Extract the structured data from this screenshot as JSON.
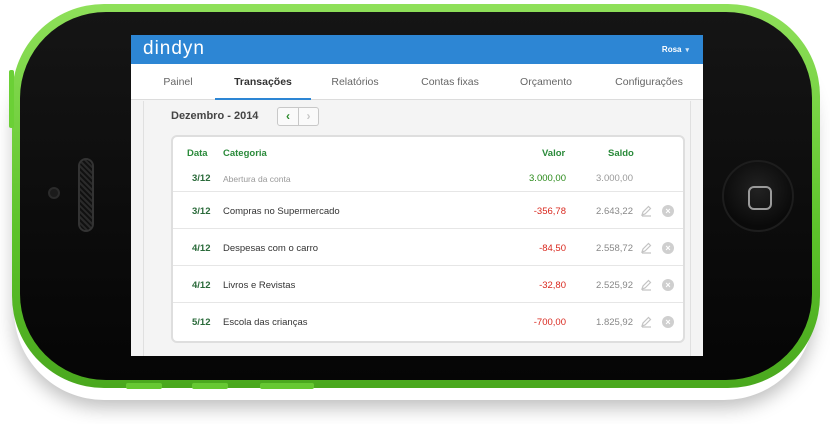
{
  "app": {
    "brand": "dindyn",
    "user": "Rosa",
    "user_caret": "▾"
  },
  "tabs": [
    {
      "label": "Painel"
    },
    {
      "label": "Transações",
      "active": true
    },
    {
      "label": "Relatórios"
    },
    {
      "label": "Contas fixas"
    },
    {
      "label": "Orçamento"
    },
    {
      "label": "Configurações"
    }
  ],
  "period": {
    "label": "Dezembro - 2014",
    "prev_icon": "‹",
    "next_icon": "›"
  },
  "table": {
    "headers": {
      "date": "Data",
      "category": "Categoria",
      "value": "Valor",
      "balance": "Saldo"
    },
    "rows": [
      {
        "date": "3/12",
        "category": "Abertura da conta",
        "value": "3.000,00",
        "balance": "3.000,00"
      },
      {
        "date": "3/12",
        "category": "Compras no Supermercado",
        "value": "-356,78",
        "balance": "2.643,22"
      },
      {
        "date": "4/12",
        "category": "Despesas com o carro",
        "value": "-84,50",
        "balance": "2.558,72"
      },
      {
        "date": "4/12",
        "category": "Livros e Revistas",
        "value": "-32,80",
        "balance": "2.525,92"
      },
      {
        "date": "5/12",
        "category": "Escola das crianças",
        "value": "-700,00",
        "balance": "1.825,92"
      }
    ]
  },
  "colors": {
    "accent": "#2d86d4",
    "positive": "#2a8a1a",
    "negative": "#d9281e",
    "phone": "#5cc22a"
  }
}
